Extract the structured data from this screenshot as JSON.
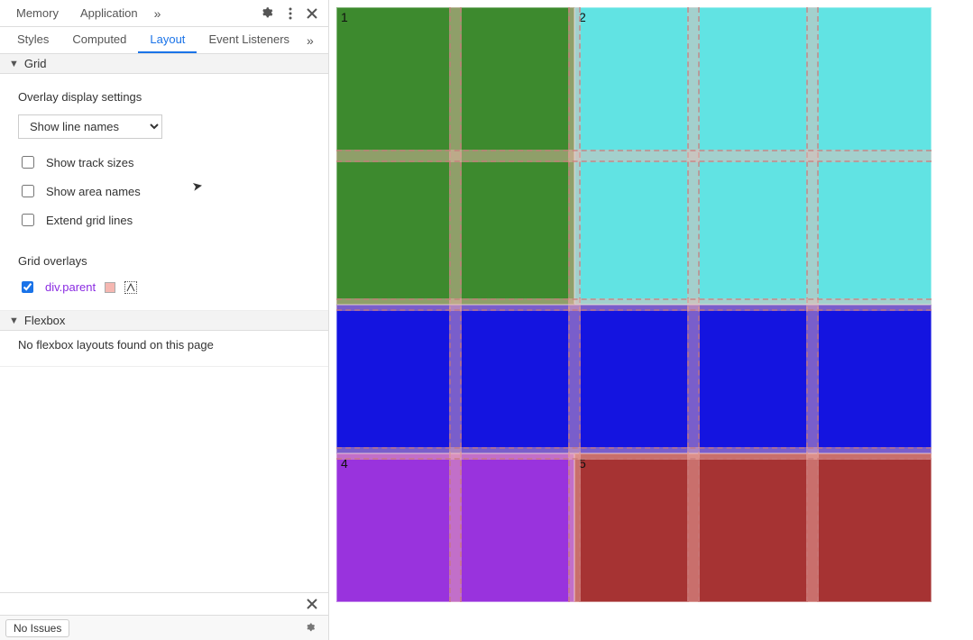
{
  "top_tabs": {
    "memory": "Memory",
    "application": "Application",
    "more": "»"
  },
  "sub_tabs": {
    "styles": "Styles",
    "computed": "Computed",
    "layout": "Layout",
    "event_listeners": "Event Listeners",
    "more": "»"
  },
  "grid_section": {
    "title": "Grid",
    "overlay_settings_heading": "Overlay display settings",
    "dropdown_selected": "Show line names",
    "cb_track_sizes": "Show track sizes",
    "cb_area_names": "Show area names",
    "cb_extend_grid_lines": "Extend grid lines",
    "grid_overlays_heading": "Grid overlays",
    "overlay_selector": "div.parent"
  },
  "flexbox_section": {
    "title": "Flexbox",
    "empty_message": "No flexbox layouts found on this page"
  },
  "bottom": {
    "issues": "No Issues"
  },
  "preview": {
    "labels": {
      "one": "1",
      "two": "2",
      "four": "4",
      "five": "5"
    },
    "colors": {
      "green": "#3d8a2e",
      "cyan": "#61e3e3",
      "blue": "#1414e0",
      "purple": "#9933dd",
      "red": "#a63333"
    }
  }
}
